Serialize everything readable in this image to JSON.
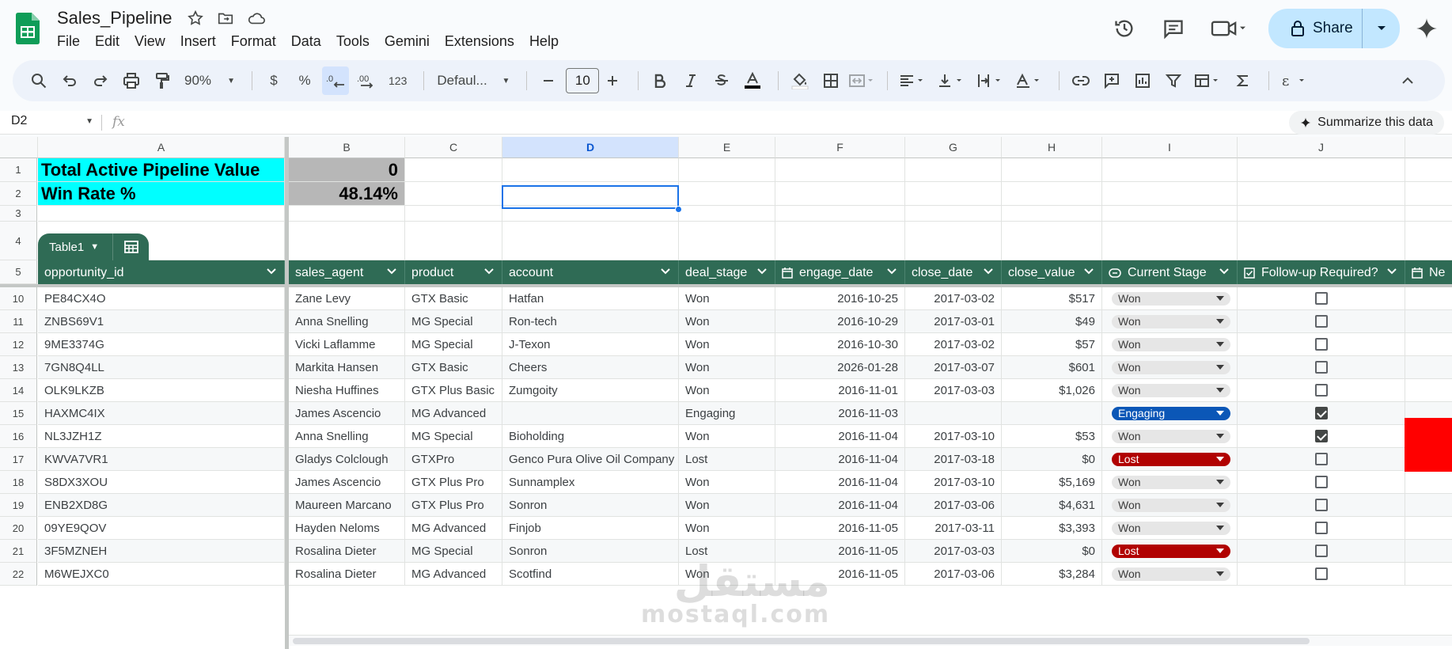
{
  "app": {
    "doc_title": "Sales_Pipeline",
    "menus": [
      "File",
      "Edit",
      "View",
      "Insert",
      "Format",
      "Data",
      "Tools",
      "Gemini",
      "Extensions",
      "Help"
    ],
    "share_label": "Share"
  },
  "toolbar": {
    "zoom": "90%",
    "currency": "$",
    "percent": "%",
    "format_123": "123",
    "font": "Defaul...",
    "font_size": "10"
  },
  "formula": {
    "name_box": "D2",
    "fx": "fx",
    "summarize_label": "Summarize this data"
  },
  "columns": [
    "A",
    "B",
    "C",
    "D",
    "E",
    "F",
    "G",
    "H",
    "I",
    "J"
  ],
  "summary": {
    "total_label": "Total Active Pipeline Value",
    "total_value": "0",
    "winrate_label": "Win Rate %",
    "winrate_value": "48.14%"
  },
  "table": {
    "name": "Table1",
    "headers": [
      "opportunity_id",
      "sales_agent",
      "product",
      "account",
      "deal_stage",
      "engage_date",
      "close_date",
      "close_value",
      "Current Stage",
      "Follow-up Required?",
      "Ne"
    ],
    "rows": [
      {
        "n": "10",
        "id": "PE84CX4O",
        "agent": "Zane Levy",
        "product": "GTX Basic",
        "account": "Hatfan",
        "stage": "Won",
        "engage": "2016-10-25",
        "close": "2017-03-02",
        "value": "$517",
        "current": "Won",
        "follow": false
      },
      {
        "n": "11",
        "id": "ZNBS69V1",
        "agent": "Anna Snelling",
        "product": "MG Special",
        "account": "Ron-tech",
        "stage": "Won",
        "engage": "2016-10-29",
        "close": "2017-03-01",
        "value": "$49",
        "current": "Won",
        "follow": false
      },
      {
        "n": "12",
        "id": "9ME3374G",
        "agent": "Vicki Laflamme",
        "product": "MG Special",
        "account": "J-Texon",
        "stage": "Won",
        "engage": "2016-10-30",
        "close": "2017-03-02",
        "value": "$57",
        "current": "Won",
        "follow": false
      },
      {
        "n": "13",
        "id": "7GN8Q4LL",
        "agent": "Markita Hansen",
        "product": "GTX Basic",
        "account": "Cheers",
        "stage": "Won",
        "engage": "2026-01-28",
        "close": "2017-03-07",
        "value": "$601",
        "current": "Won",
        "follow": false
      },
      {
        "n": "14",
        "id": "OLK9LKZB",
        "agent": "Niesha Huffines",
        "product": "GTX Plus Basic",
        "account": "Zumgoity",
        "stage": "Won",
        "engage": "2016-11-01",
        "close": "2017-03-03",
        "value": "$1,026",
        "current": "Won",
        "follow": false
      },
      {
        "n": "15",
        "id": "HAXMC4IX",
        "agent": "James Ascencio",
        "product": "MG Advanced",
        "account": "",
        "stage": "Engaging",
        "engage": "2016-11-03",
        "close": "",
        "value": "",
        "current": "Engaging",
        "follow": true
      },
      {
        "n": "16",
        "id": "NL3JZH1Z",
        "agent": "Anna Snelling",
        "product": "MG Special",
        "account": "Bioholding",
        "stage": "Won",
        "engage": "2016-11-04",
        "close": "2017-03-10",
        "value": "$53",
        "current": "Won",
        "follow": true
      },
      {
        "n": "17",
        "id": "KWVA7VR1",
        "agent": "Gladys Colclough",
        "product": "GTXPro",
        "account": "Genco Pura Olive Oil Company",
        "stage": "Lost",
        "engage": "2016-11-04",
        "close": "2017-03-18",
        "value": "$0",
        "current": "Lost",
        "follow": false
      },
      {
        "n": "18",
        "id": "S8DX3XOU",
        "agent": "James Ascencio",
        "product": "GTX Plus Pro",
        "account": "Sunnamplex",
        "stage": "Won",
        "engage": "2016-11-04",
        "close": "2017-03-10",
        "value": "$5,169",
        "current": "Won",
        "follow": false
      },
      {
        "n": "19",
        "id": "ENB2XD8G",
        "agent": "Maureen Marcano",
        "product": "GTX Plus Pro",
        "account": "Sonron",
        "stage": "Won",
        "engage": "2016-11-04",
        "close": "2017-03-06",
        "value": "$4,631",
        "current": "Won",
        "follow": false
      },
      {
        "n": "20",
        "id": "09YE9QOV",
        "agent": "Hayden Neloms",
        "product": "MG Advanced",
        "account": "Finjob",
        "stage": "Won",
        "engage": "2016-11-05",
        "close": "2017-03-11",
        "value": "$3,393",
        "current": "Won",
        "follow": false
      },
      {
        "n": "21",
        "id": "3F5MZNEH",
        "agent": "Rosalina Dieter",
        "product": "MG Special",
        "account": "Sonron",
        "stage": "Lost",
        "engage": "2016-11-05",
        "close": "2017-03-03",
        "value": "$0",
        "current": "Lost",
        "follow": false
      },
      {
        "n": "22",
        "id": "M6WEJXC0",
        "agent": "Rosalina Dieter",
        "product": "MG Advanced",
        "account": "Scotfind",
        "stage": "Won",
        "engage": "2016-11-05",
        "close": "2017-03-06",
        "value": "$3,284",
        "current": "Won",
        "follow": false
      }
    ]
  },
  "watermark": {
    "arabic": "مستقل",
    "latin": "mostaql.com"
  },
  "colors": {
    "table_header": "#2f6b55",
    "summary_label_bg": "#00ffff",
    "summary_value_bg": "#b7b7b7",
    "won_chip": "#e6e6e6",
    "engaging_chip": "#0b57b7",
    "lost_chip": "#b10202",
    "accent": "#1a73e8"
  }
}
